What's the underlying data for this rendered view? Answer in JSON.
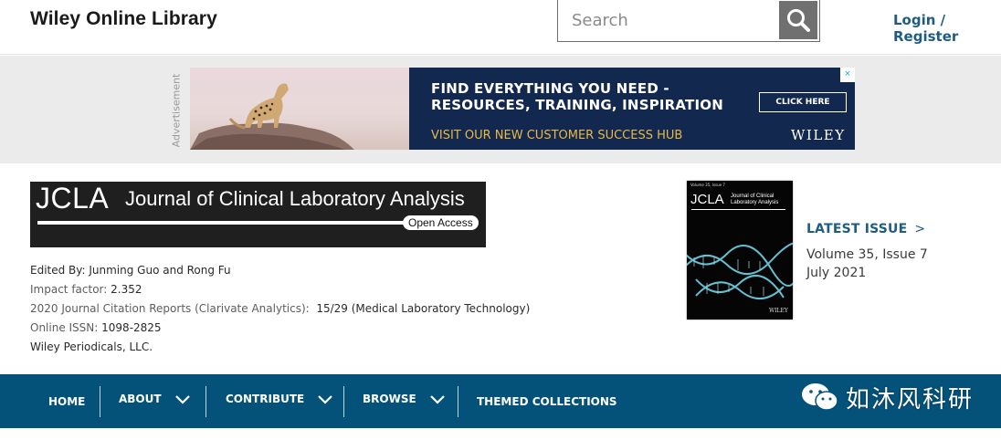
{
  "header": {
    "brand": "Wiley Online Library",
    "search_placeholder": "Search",
    "login_label": "Login / Register"
  },
  "ad": {
    "label": "Advertisement",
    "headline": "FIND EVERYTHING YOU NEED - RESOURCES, TRAINING, INSPIRATION",
    "cta": "CLICK HERE",
    "subline": "VISIT OUR NEW CUSTOMER SUCCESS HUB",
    "logo": "WILEY",
    "close": "×"
  },
  "journal": {
    "abbr": "JCLA",
    "title": "Journal of Clinical Laboratory Analysis",
    "badge": "Open Access",
    "edited_by": "Edited By: Junming Guo and Rong Fu",
    "impact_label": "Impact factor:",
    "impact_value": "2.352",
    "jcr_label": "2020 Journal Citation Reports (Clarivate Analytics):",
    "jcr_value": "15/29 (Medical Laboratory Technology)",
    "issn_label": "Online ISSN:",
    "issn_value": "1098-2825",
    "publisher": "Wiley Periodicals, LLC."
  },
  "cover": {
    "volume_line": "Volume 35, Issue 7",
    "abbr": "JCLA",
    "title": "Journal of Clinical Laboratory Analysis",
    "publisher": "WILEY"
  },
  "latest": {
    "label": "LATEST ISSUE",
    "arrow": ">",
    "issue": "Volume 35, Issue 7",
    "date": "July 2021"
  },
  "nav": {
    "items": [
      {
        "label": "HOME"
      },
      {
        "label": "ABOUT"
      },
      {
        "label": "CONTRIBUTE"
      },
      {
        "label": "BROWSE"
      },
      {
        "label": "THEMED COLLECTIONS"
      }
    ]
  },
  "watermark": {
    "text": "如沐风科研"
  },
  "colors": {
    "nav_bg": "#04527a",
    "link": "#1e5c82",
    "ad_panel": "#13284e",
    "ad_gold": "#e8b84a"
  }
}
